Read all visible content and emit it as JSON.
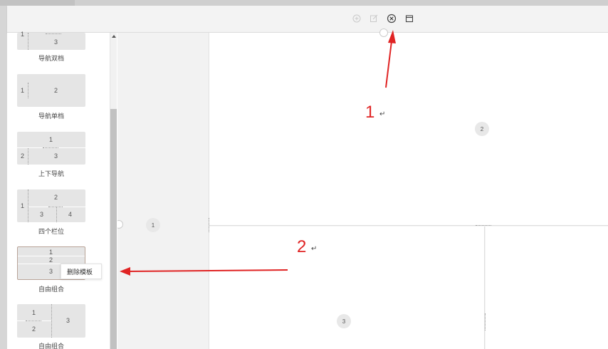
{
  "toolbar": {
    "buttons": [
      {
        "name": "add",
        "icon": "plus-circle-icon"
      },
      {
        "name": "edit",
        "icon": "edit-icon"
      },
      {
        "name": "close",
        "icon": "close-circle-icon"
      },
      {
        "name": "save",
        "icon": "calendar-icon"
      }
    ]
  },
  "templates": [
    {
      "label": "导航双档",
      "numbers": [
        "1",
        "3"
      ]
    },
    {
      "label": "导航单档",
      "numbers": [
        "1",
        "2"
      ]
    },
    {
      "label": "上下导航",
      "numbers": [
        "1",
        "2",
        "3"
      ]
    },
    {
      "label": "四个栏位",
      "numbers": [
        "1",
        "2",
        "3",
        "4"
      ]
    },
    {
      "label": "自由组合",
      "numbers": [
        "1",
        "2",
        "3"
      ]
    },
    {
      "label": "自由组合",
      "numbers": [
        "1",
        "2",
        "3"
      ]
    }
  ],
  "context_menu": {
    "delete_template": "删除模板"
  },
  "canvas": {
    "regions": [
      "1",
      "2",
      "3"
    ]
  },
  "annotations": {
    "first": "1",
    "second": "2",
    "return_mark": "↵"
  },
  "colors": {
    "annotation": "#e02424",
    "toolbar_bg": "#f3f3f3",
    "template_bg": "#e5e5e5",
    "selected_border": "#b8a397"
  }
}
